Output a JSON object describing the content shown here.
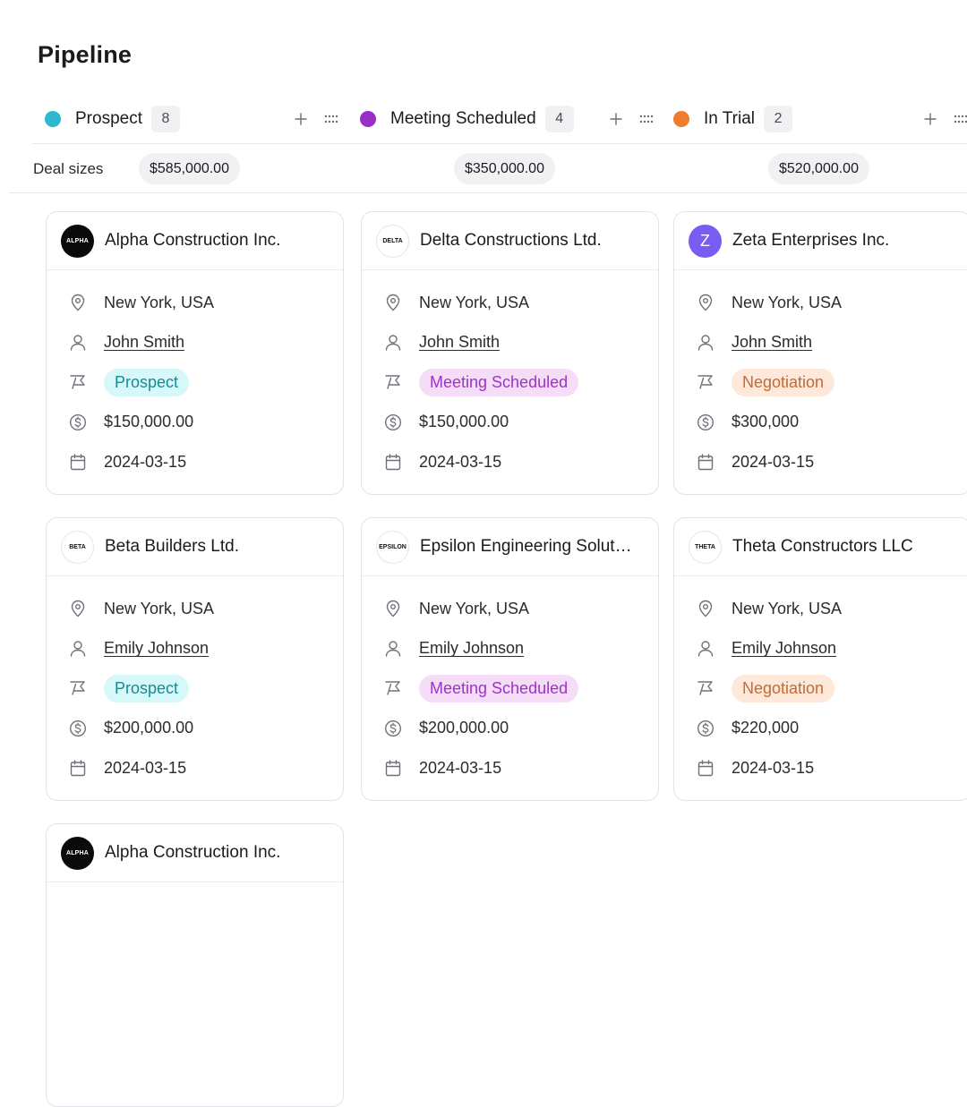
{
  "page": {
    "title": "Pipeline"
  },
  "deal_sizes_label": "Deal sizes",
  "columns": [
    {
      "name": "Prospect",
      "count": "8",
      "color": "#2cb8cf",
      "deal_size": "$585,000.00"
    },
    {
      "name": "Meeting Scheduled",
      "count": "4",
      "color": "#9a2ec9",
      "deal_size": "$350,000.00"
    },
    {
      "name": "In Trial",
      "count": "2",
      "color": "#ef7d2b",
      "deal_size": "$520,000.00"
    }
  ],
  "stage_styles": {
    "Prospect": {
      "bg": "#d6f8f8",
      "fg": "#178a98"
    },
    "Meeting Scheduled": {
      "bg": "#f5ddf8",
      "fg": "#9b34c4"
    },
    "Negotiation": {
      "bg": "#fde8da",
      "fg": "#c26b35"
    }
  },
  "cards": [
    {
      "company": "Alpha Construction Inc.",
      "logo_text": "ALPHA",
      "logo_style": "black",
      "location": "New York, USA",
      "contact": "John Smith",
      "stage": "Prospect",
      "amount": "$150,000.00",
      "date": "2024-03-15"
    },
    {
      "company": "Delta Constructions Ltd.",
      "logo_text": "DELTA",
      "logo_style": "white",
      "location": "New York, USA",
      "contact": "John Smith",
      "stage": "Meeting Scheduled",
      "amount": "$150,000.00",
      "date": "2024-03-15"
    },
    {
      "company": "Zeta Enterprises Inc.",
      "logo_text": "Z",
      "logo_style": "purple",
      "location": "New York, USA",
      "contact": "John Smith",
      "stage": "Negotiation",
      "amount": "$300,000",
      "date": "2024-03-15"
    },
    {
      "company": "Beta Builders Ltd.",
      "logo_text": "BETA",
      "logo_style": "white",
      "location": "New York, USA",
      "contact": "Emily Johnson",
      "stage": "Prospect",
      "amount": "$200,000.00",
      "date": "2024-03-15"
    },
    {
      "company": "Epsilon Engineering Solut…",
      "logo_text": "EPSILON",
      "logo_style": "white",
      "location": "New York, USA",
      "contact": "Emily Johnson",
      "stage": "Meeting Scheduled",
      "amount": "$200,000.00",
      "date": "2024-03-15"
    },
    {
      "company": "Theta Constructors LLC",
      "logo_text": "THETA",
      "logo_style": "white",
      "location": "New York, USA",
      "contact": "Emily Johnson",
      "stage": "Negotiation",
      "amount": "$220,000",
      "date": "2024-03-15"
    },
    {
      "company": "Alpha Construction Inc.",
      "logo_text": "ALPHA",
      "logo_style": "black"
    }
  ],
  "icons": {
    "add": "plus-icon",
    "drag": "drag-handle-icon",
    "location": "map-pin-icon",
    "contact": "user-icon",
    "stage": "flag-icon",
    "amount": "dollar-circle-icon",
    "date": "calendar-icon"
  }
}
